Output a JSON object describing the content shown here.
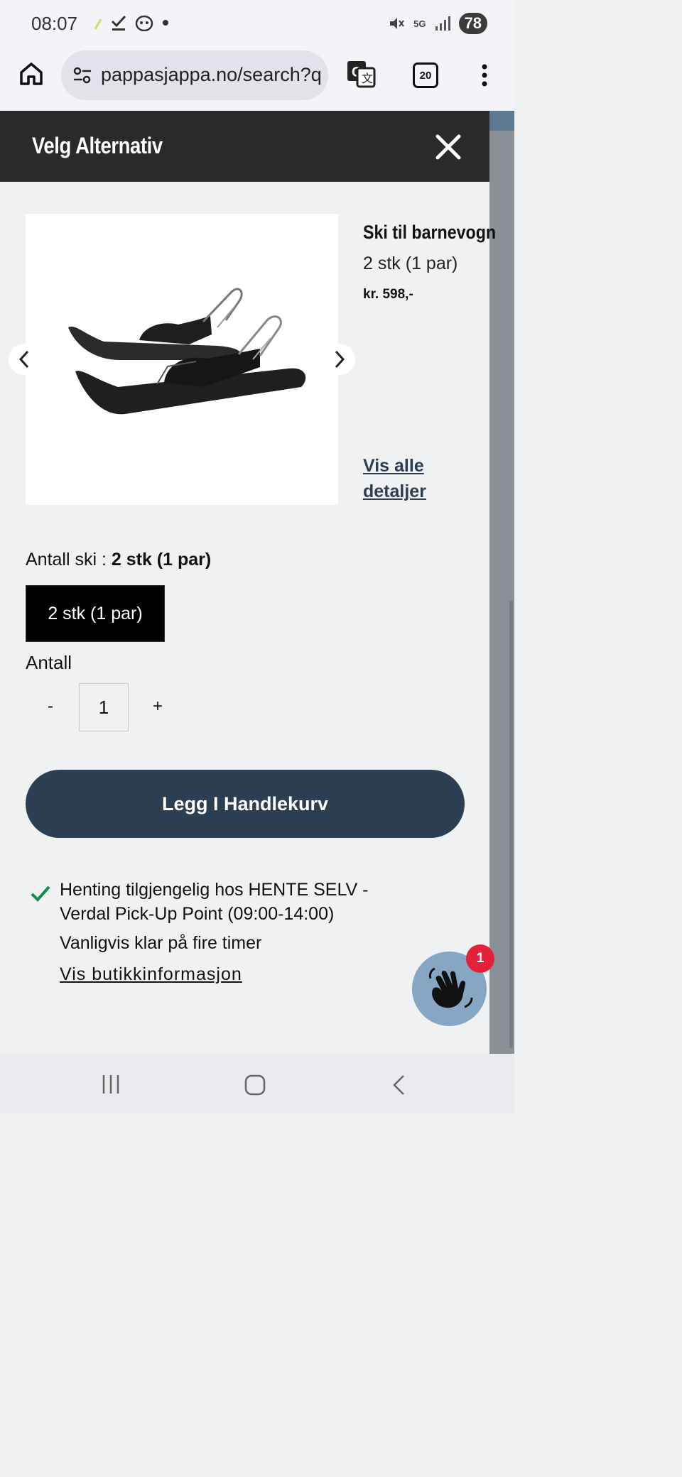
{
  "status_bar": {
    "time": "08:07",
    "battery": "78",
    "network": "5G",
    "left_icons": [
      "leaf-icon",
      "checkmark-icon",
      "app-face-icon",
      "dot-icon"
    ],
    "right_icons": [
      "mute-icon",
      "5g-icon",
      "signal-icon",
      "battery-icon"
    ]
  },
  "browser": {
    "url": "pappasjappa.no/search?q=ski",
    "tab_count": "20",
    "icons": [
      "home-icon",
      "site-settings-icon",
      "translate-icon",
      "tabs-icon",
      "more-menu-icon"
    ]
  },
  "modal": {
    "title": "Velg Alternativ",
    "close_icon": "close-icon"
  },
  "product": {
    "title": "Ski til barnevogn",
    "variant": "2 stk (1 par)",
    "price": "kr. 598,-",
    "details_link": "Vis alle detaljer",
    "image": "stroller-ski-pair"
  },
  "options": {
    "label": "Antall ski : ",
    "selected": "2 stk (1 par)",
    "choices": [
      "2 stk (1 par)"
    ]
  },
  "quantity": {
    "label": "Antall",
    "minus": "-",
    "value": "1",
    "plus": "+"
  },
  "add_to_cart": "Legg I Handlekurv",
  "pickup": {
    "availability": "Henting tilgjengelig hos HENTE SELV - Verdal Pick-Up Point (09:00-14:00)",
    "ready": "Vanligvis klar på fire timer",
    "store_link": "Vis butikkinformasjon"
  },
  "chat": {
    "badge": "1",
    "icon": "waving-hand-icon"
  },
  "colors": {
    "header": "#2a2a2a",
    "accent": "#2c3e52",
    "badge": "#e3213b",
    "check": "#1a8a4a"
  }
}
